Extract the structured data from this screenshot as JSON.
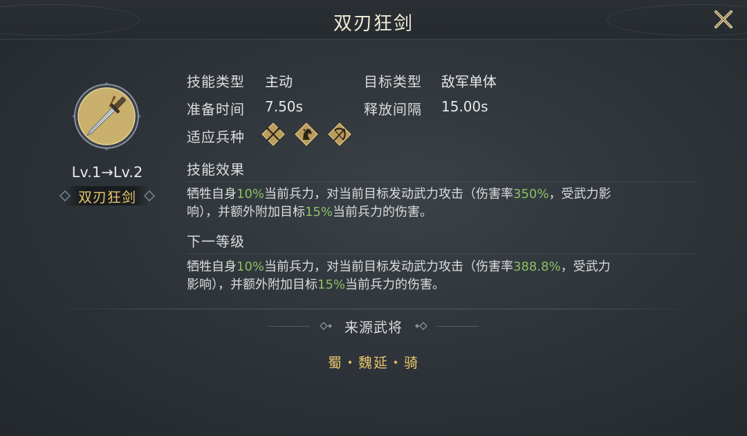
{
  "header": {
    "title": "双刃狂剑"
  },
  "skill": {
    "icon": "twin-blade-sword-icon",
    "level": "Lv.1→Lv.2",
    "name": "双刃狂剑"
  },
  "attributes": {
    "skill_type_label": "技能类型",
    "skill_type_value": "主动",
    "target_type_label": "目标类型",
    "target_type_value": "敌军单体",
    "prep_time_label": "准备时间",
    "prep_time_value": "7.50s",
    "cast_interval_label": "释放间隔",
    "cast_interval_value": "15.00s",
    "troop_label": "适应兵种",
    "troops": [
      "crossed-spears-icon",
      "horse-icon",
      "bow-icon"
    ]
  },
  "effect": {
    "title": "技能效果",
    "line1": {
      "p1": "牺牲自身",
      "v1": "10%",
      "p2": "当前兵力，对当前目标发动武力攻击（伤害率",
      "v2": "350%",
      "p3": "，受武力影"
    },
    "line2": {
      "p1": "响），并额外附加目标",
      "v1": "15%",
      "p2": "当前兵力的伤害。"
    }
  },
  "next_level": {
    "title": "下一等级",
    "line1": {
      "p1": "牺牲自身",
      "v1": "10%",
      "p2": "当前兵力，对当前目标发动武力攻击（伤害率",
      "v2": "388.8%",
      "p3": "，受武力"
    },
    "line2": {
      "p1": "影响），并额外附加目标",
      "v1": "15%",
      "p2": "当前兵力的伤害。"
    }
  },
  "source": {
    "title": "来源武将",
    "general": "蜀・魏延・骑"
  },
  "colors": {
    "gold": "#e8c46a",
    "highlight_green": "#8cc063"
  }
}
